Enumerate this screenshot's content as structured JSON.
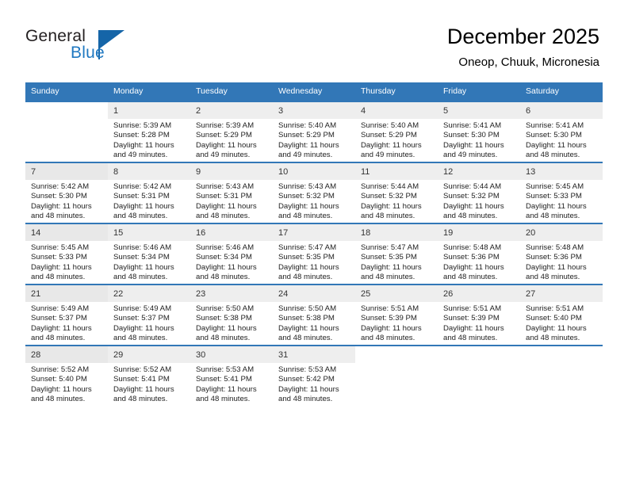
{
  "brand": {
    "name_part1": "General",
    "name_part2": "Blue",
    "logo_icon": "flag-triangle-icon"
  },
  "header": {
    "title": "December 2025",
    "subtitle": "Oneop, Chuuk, Micronesia"
  },
  "calendar": {
    "weekday_headers": [
      "Sunday",
      "Monday",
      "Tuesday",
      "Wednesday",
      "Thursday",
      "Friday",
      "Saturday"
    ],
    "colors": {
      "header_blue": "#3277b7",
      "brand_blue": "#1f78c1",
      "daynum_bg": "#eeeeee",
      "sunday_bg": "#f4f4f4"
    },
    "weeks": [
      [
        {
          "day": "",
          "sunrise": "",
          "sunset": "",
          "daylight": ""
        },
        {
          "day": "1",
          "sunrise": "Sunrise: 5:39 AM",
          "sunset": "Sunset: 5:28 PM",
          "daylight": "Daylight: 11 hours and 49 minutes."
        },
        {
          "day": "2",
          "sunrise": "Sunrise: 5:39 AM",
          "sunset": "Sunset: 5:29 PM",
          "daylight": "Daylight: 11 hours and 49 minutes."
        },
        {
          "day": "3",
          "sunrise": "Sunrise: 5:40 AM",
          "sunset": "Sunset: 5:29 PM",
          "daylight": "Daylight: 11 hours and 49 minutes."
        },
        {
          "day": "4",
          "sunrise": "Sunrise: 5:40 AM",
          "sunset": "Sunset: 5:29 PM",
          "daylight": "Daylight: 11 hours and 49 minutes."
        },
        {
          "day": "5",
          "sunrise": "Sunrise: 5:41 AM",
          "sunset": "Sunset: 5:30 PM",
          "daylight": "Daylight: 11 hours and 49 minutes."
        },
        {
          "day": "6",
          "sunrise": "Sunrise: 5:41 AM",
          "sunset": "Sunset: 5:30 PM",
          "daylight": "Daylight: 11 hours and 48 minutes."
        }
      ],
      [
        {
          "day": "7",
          "sunrise": "Sunrise: 5:42 AM",
          "sunset": "Sunset: 5:30 PM",
          "daylight": "Daylight: 11 hours and 48 minutes."
        },
        {
          "day": "8",
          "sunrise": "Sunrise: 5:42 AM",
          "sunset": "Sunset: 5:31 PM",
          "daylight": "Daylight: 11 hours and 48 minutes."
        },
        {
          "day": "9",
          "sunrise": "Sunrise: 5:43 AM",
          "sunset": "Sunset: 5:31 PM",
          "daylight": "Daylight: 11 hours and 48 minutes."
        },
        {
          "day": "10",
          "sunrise": "Sunrise: 5:43 AM",
          "sunset": "Sunset: 5:32 PM",
          "daylight": "Daylight: 11 hours and 48 minutes."
        },
        {
          "day": "11",
          "sunrise": "Sunrise: 5:44 AM",
          "sunset": "Sunset: 5:32 PM",
          "daylight": "Daylight: 11 hours and 48 minutes."
        },
        {
          "day": "12",
          "sunrise": "Sunrise: 5:44 AM",
          "sunset": "Sunset: 5:32 PM",
          "daylight": "Daylight: 11 hours and 48 minutes."
        },
        {
          "day": "13",
          "sunrise": "Sunrise: 5:45 AM",
          "sunset": "Sunset: 5:33 PM",
          "daylight": "Daylight: 11 hours and 48 minutes."
        }
      ],
      [
        {
          "day": "14",
          "sunrise": "Sunrise: 5:45 AM",
          "sunset": "Sunset: 5:33 PM",
          "daylight": "Daylight: 11 hours and 48 minutes."
        },
        {
          "day": "15",
          "sunrise": "Sunrise: 5:46 AM",
          "sunset": "Sunset: 5:34 PM",
          "daylight": "Daylight: 11 hours and 48 minutes."
        },
        {
          "day": "16",
          "sunrise": "Sunrise: 5:46 AM",
          "sunset": "Sunset: 5:34 PM",
          "daylight": "Daylight: 11 hours and 48 minutes."
        },
        {
          "day": "17",
          "sunrise": "Sunrise: 5:47 AM",
          "sunset": "Sunset: 5:35 PM",
          "daylight": "Daylight: 11 hours and 48 minutes."
        },
        {
          "day": "18",
          "sunrise": "Sunrise: 5:47 AM",
          "sunset": "Sunset: 5:35 PM",
          "daylight": "Daylight: 11 hours and 48 minutes."
        },
        {
          "day": "19",
          "sunrise": "Sunrise: 5:48 AM",
          "sunset": "Sunset: 5:36 PM",
          "daylight": "Daylight: 11 hours and 48 minutes."
        },
        {
          "day": "20",
          "sunrise": "Sunrise: 5:48 AM",
          "sunset": "Sunset: 5:36 PM",
          "daylight": "Daylight: 11 hours and 48 minutes."
        }
      ],
      [
        {
          "day": "21",
          "sunrise": "Sunrise: 5:49 AM",
          "sunset": "Sunset: 5:37 PM",
          "daylight": "Daylight: 11 hours and 48 minutes."
        },
        {
          "day": "22",
          "sunrise": "Sunrise: 5:49 AM",
          "sunset": "Sunset: 5:37 PM",
          "daylight": "Daylight: 11 hours and 48 minutes."
        },
        {
          "day": "23",
          "sunrise": "Sunrise: 5:50 AM",
          "sunset": "Sunset: 5:38 PM",
          "daylight": "Daylight: 11 hours and 48 minutes."
        },
        {
          "day": "24",
          "sunrise": "Sunrise: 5:50 AM",
          "sunset": "Sunset: 5:38 PM",
          "daylight": "Daylight: 11 hours and 48 minutes."
        },
        {
          "day": "25",
          "sunrise": "Sunrise: 5:51 AM",
          "sunset": "Sunset: 5:39 PM",
          "daylight": "Daylight: 11 hours and 48 minutes."
        },
        {
          "day": "26",
          "sunrise": "Sunrise: 5:51 AM",
          "sunset": "Sunset: 5:39 PM",
          "daylight": "Daylight: 11 hours and 48 minutes."
        },
        {
          "day": "27",
          "sunrise": "Sunrise: 5:51 AM",
          "sunset": "Sunset: 5:40 PM",
          "daylight": "Daylight: 11 hours and 48 minutes."
        }
      ],
      [
        {
          "day": "28",
          "sunrise": "Sunrise: 5:52 AM",
          "sunset": "Sunset: 5:40 PM",
          "daylight": "Daylight: 11 hours and 48 minutes."
        },
        {
          "day": "29",
          "sunrise": "Sunrise: 5:52 AM",
          "sunset": "Sunset: 5:41 PM",
          "daylight": "Daylight: 11 hours and 48 minutes."
        },
        {
          "day": "30",
          "sunrise": "Sunrise: 5:53 AM",
          "sunset": "Sunset: 5:41 PM",
          "daylight": "Daylight: 11 hours and 48 minutes."
        },
        {
          "day": "31",
          "sunrise": "Sunrise: 5:53 AM",
          "sunset": "Sunset: 5:42 PM",
          "daylight": "Daylight: 11 hours and 48 minutes."
        },
        {
          "day": "",
          "sunrise": "",
          "sunset": "",
          "daylight": ""
        },
        {
          "day": "",
          "sunrise": "",
          "sunset": "",
          "daylight": ""
        },
        {
          "day": "",
          "sunrise": "",
          "sunset": "",
          "daylight": ""
        }
      ]
    ]
  }
}
